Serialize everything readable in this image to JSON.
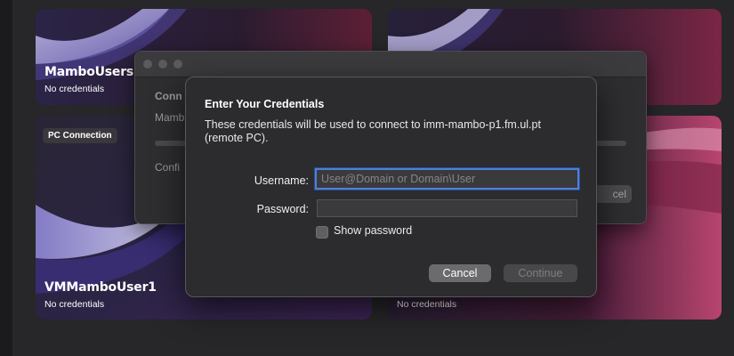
{
  "cards": [
    {
      "title": "MamboUsers",
      "subtitle": "No credentials",
      "badge": ""
    },
    {
      "title": "",
      "subtitle": "",
      "badge": ""
    },
    {
      "title": "VMMamboUser1",
      "subtitle": "No credentials",
      "badge": "PC Connection"
    },
    {
      "title": "",
      "subtitle": "No credentials",
      "badge": ""
    }
  ],
  "back_window": {
    "heading_partial": "Conn",
    "name_partial": "Mamb",
    "config_partial": "Confi",
    "button_partial": "cel"
  },
  "dialog": {
    "title": "Enter Your Credentials",
    "description": "These credentials will be used to connect to imm-mambo-p1.fm.ul.pt (remote PC).",
    "username_label": "Username:",
    "username_placeholder": "User@Domain or Domain\\User",
    "username_value": "",
    "password_label": "Password:",
    "password_value": "",
    "show_password_label": "Show password",
    "show_password_checked": false,
    "cancel_label": "Cancel",
    "continue_label": "Continue",
    "continue_enabled": false
  },
  "colors": {
    "focus_ring": "#4f7fd9",
    "wallpaper_accent": "#b8456e",
    "window_bg": "#2c2b2e"
  }
}
